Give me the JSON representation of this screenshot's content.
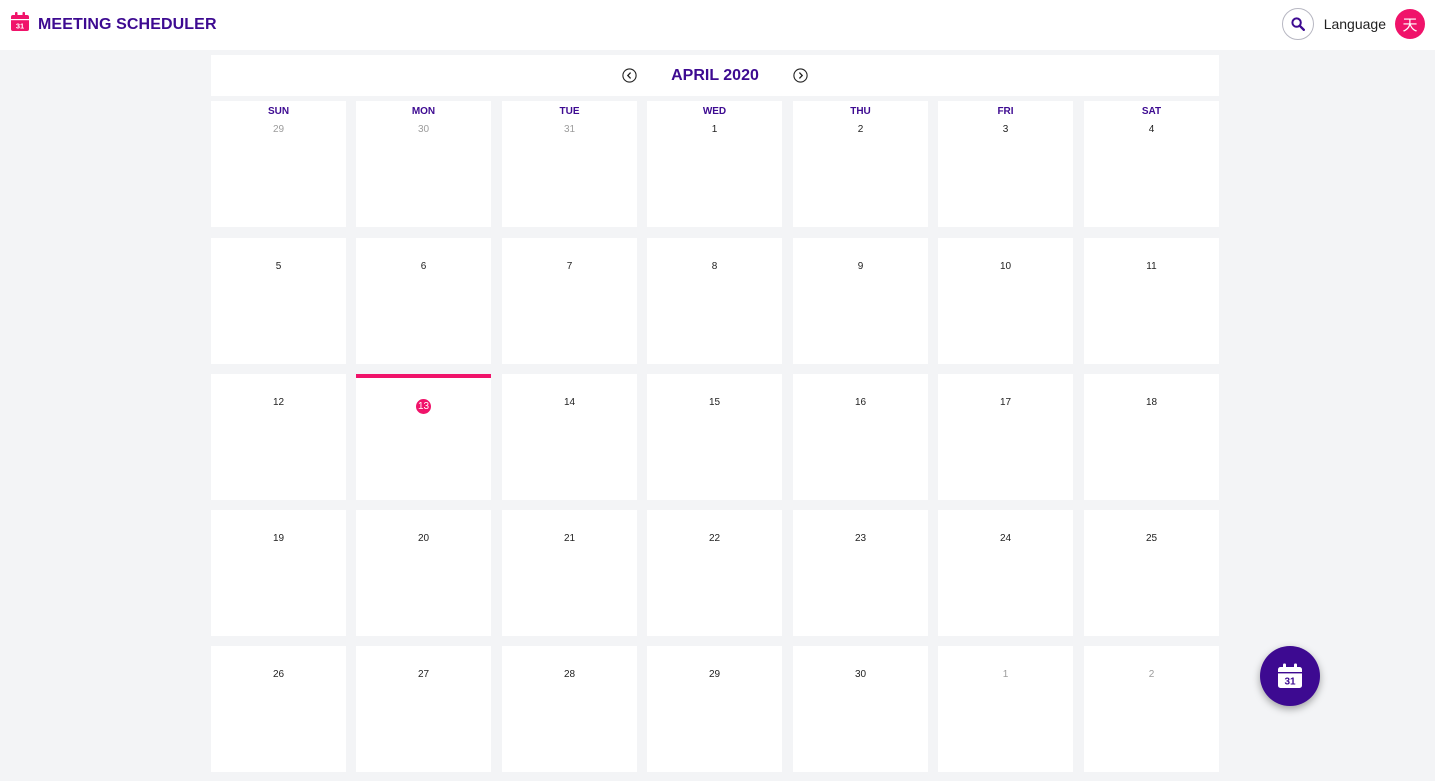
{
  "header": {
    "app_title": "MEETING SCHEDULER",
    "app_icon_day": "31",
    "language_label": "Language",
    "language_glyph": "天",
    "search_icon": "search-icon"
  },
  "calendar": {
    "month_title": "APRIL 2020",
    "weekdays": [
      "SUN",
      "MON",
      "TUE",
      "WED",
      "THU",
      "FRI",
      "SAT"
    ],
    "weeks": [
      [
        {
          "d": "29",
          "muted": true
        },
        {
          "d": "30",
          "muted": true
        },
        {
          "d": "31",
          "muted": true
        },
        {
          "d": "1"
        },
        {
          "d": "2"
        },
        {
          "d": "3"
        },
        {
          "d": "4"
        }
      ],
      [
        {
          "d": "5"
        },
        {
          "d": "6"
        },
        {
          "d": "7"
        },
        {
          "d": "8"
        },
        {
          "d": "9"
        },
        {
          "d": "10"
        },
        {
          "d": "11"
        }
      ],
      [
        {
          "d": "12"
        },
        {
          "d": "13",
          "today": true
        },
        {
          "d": "14"
        },
        {
          "d": "15"
        },
        {
          "d": "16"
        },
        {
          "d": "17"
        },
        {
          "d": "18"
        }
      ],
      [
        {
          "d": "19"
        },
        {
          "d": "20"
        },
        {
          "d": "21"
        },
        {
          "d": "22"
        },
        {
          "d": "23"
        },
        {
          "d": "24"
        },
        {
          "d": "25"
        }
      ],
      [
        {
          "d": "26"
        },
        {
          "d": "27"
        },
        {
          "d": "28"
        },
        {
          "d": "29"
        },
        {
          "d": "30"
        },
        {
          "d": "1",
          "muted": true
        },
        {
          "d": "2",
          "muted": true
        }
      ]
    ]
  },
  "fab": {
    "icon": "calendar-add-icon",
    "day": "31"
  },
  "colors": {
    "brand": "#3d0a91",
    "accent": "#f0136a",
    "background": "#f3f4f6",
    "muted_text": "#9c9c9c"
  }
}
